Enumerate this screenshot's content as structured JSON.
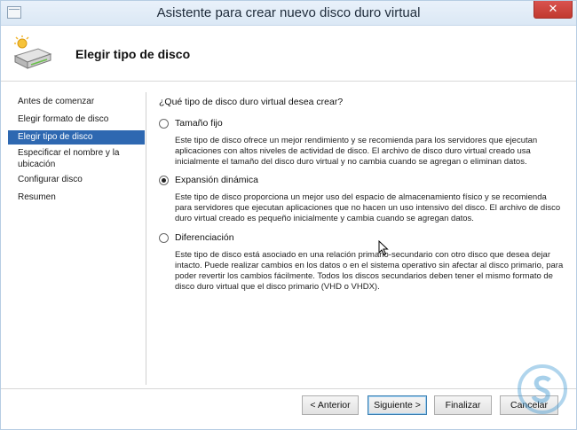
{
  "window": {
    "title": "Asistente para crear nuevo disco duro virtual",
    "close_icon": "close-icon"
  },
  "header": {
    "title": "Elegir tipo de disco",
    "icon": "virtual-disk-icon"
  },
  "sidebar": {
    "items": [
      {
        "label": "Antes de comenzar",
        "active": false
      },
      {
        "label": "Elegir formato de disco",
        "active": false
      },
      {
        "label": "Elegir tipo de disco",
        "active": true
      },
      {
        "label": "Especificar el nombre y la ubicación",
        "active": false
      },
      {
        "label": "Configurar disco",
        "active": false
      },
      {
        "label": "Resumen",
        "active": false
      }
    ]
  },
  "main": {
    "question": "¿Qué tipo de disco duro virtual desea crear?",
    "options": [
      {
        "label": "Tamaño fijo",
        "selected": false,
        "description": "Este tipo de disco ofrece un mejor rendimiento y se recomienda para los servidores que ejecutan aplicaciones con altos niveles de actividad de disco. El archivo de disco duro virtual creado usa inicialmente el tamaño del disco duro virtual y no cambia cuando se agregan o eliminan datos."
      },
      {
        "label": "Expansión dinámica",
        "selected": true,
        "description": "Este tipo de disco proporciona un mejor uso del espacio de almacenamiento físico y se recomienda para servidores que ejecutan aplicaciones que no hacen un uso intensivo del disco. El archivo de disco duro virtual creado es pequeño inicialmente y cambia cuando se agregan datos."
      },
      {
        "label": "Diferenciación",
        "selected": false,
        "description": "Este tipo de disco está asociado en una relación primario-secundario con otro disco que desea dejar intacto. Puede realizar cambios en los datos o en el sistema operativo sin afectar al disco primario, para poder revertir los cambios fácilmente. Todos los discos secundarios deben tener el mismo formato de disco duro virtual que el disco primario (VHD o VHDX)."
      }
    ]
  },
  "footer": {
    "previous_label": "< Anterior",
    "next_label": "Siguiente >",
    "finish_label": "Finalizar",
    "cancel_label": "Cancelar"
  }
}
